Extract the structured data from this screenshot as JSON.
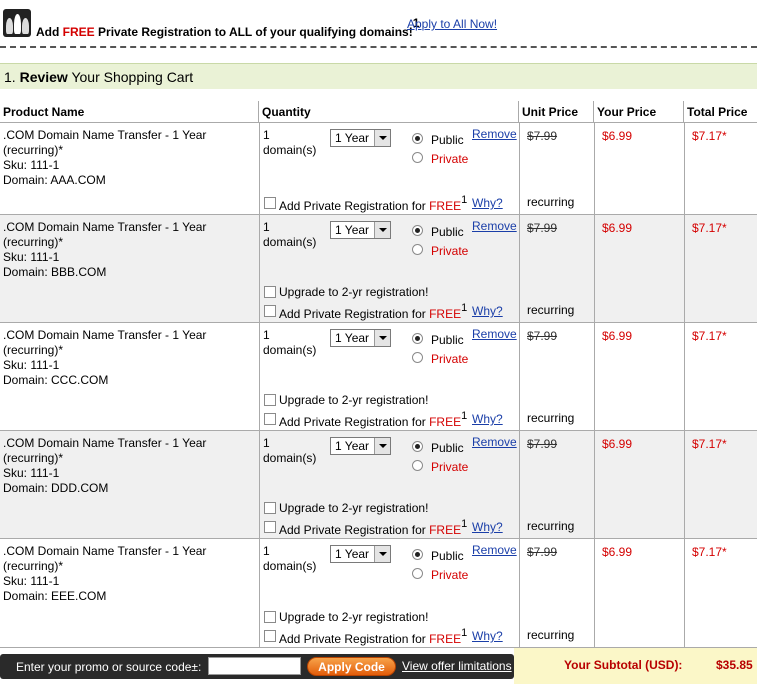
{
  "promo": {
    "text_before": "Add ",
    "free": "FREE",
    "text_after": " Private Registration to ALL of your qualifying domains!",
    "superscript": "1",
    "apply_link": "Apply to All Now!"
  },
  "section": {
    "number": "1.",
    "bold": "Review",
    "rest": " Your Shopping Cart"
  },
  "columns": [
    "Product Name",
    "Quantity",
    "Unit Price",
    "Your Price",
    "Total Price"
  ],
  "common": {
    "product_line1": ".COM Domain Name Transfer - 1 Year",
    "product_line2": "(recurring)*",
    "sku": "Sku: 111-1",
    "qty_count": "1",
    "qty_unit": "domain(s)",
    "term": "1 Year",
    "public": "Public",
    "private": "Private",
    "remove": "Remove",
    "unit_price": "$7.99",
    "your_price": "$6.99",
    "total_price": "$7.17*",
    "upgrade": "Upgrade to 2-yr registration!",
    "add_priv_before": "Add Private Registration for ",
    "add_priv_free": "FREE",
    "add_priv_sup": "1",
    "why": "Why?",
    "recurring": "recurring"
  },
  "items": [
    {
      "domain": "Domain: AAA.COM"
    },
    {
      "domain": "Domain: BBB.COM"
    },
    {
      "domain": "Domain: CCC.COM"
    },
    {
      "domain": "Domain: DDD.COM"
    },
    {
      "domain": "Domain: EEE.COM"
    }
  ],
  "footer": {
    "promo_label": "Enter your promo or source code±:",
    "promo_value": "",
    "apply_button": "Apply Code",
    "offer_link": "View offer limitations",
    "subtotal_label": "Your Subtotal (USD):",
    "subtotal_value": "$35.85"
  }
}
